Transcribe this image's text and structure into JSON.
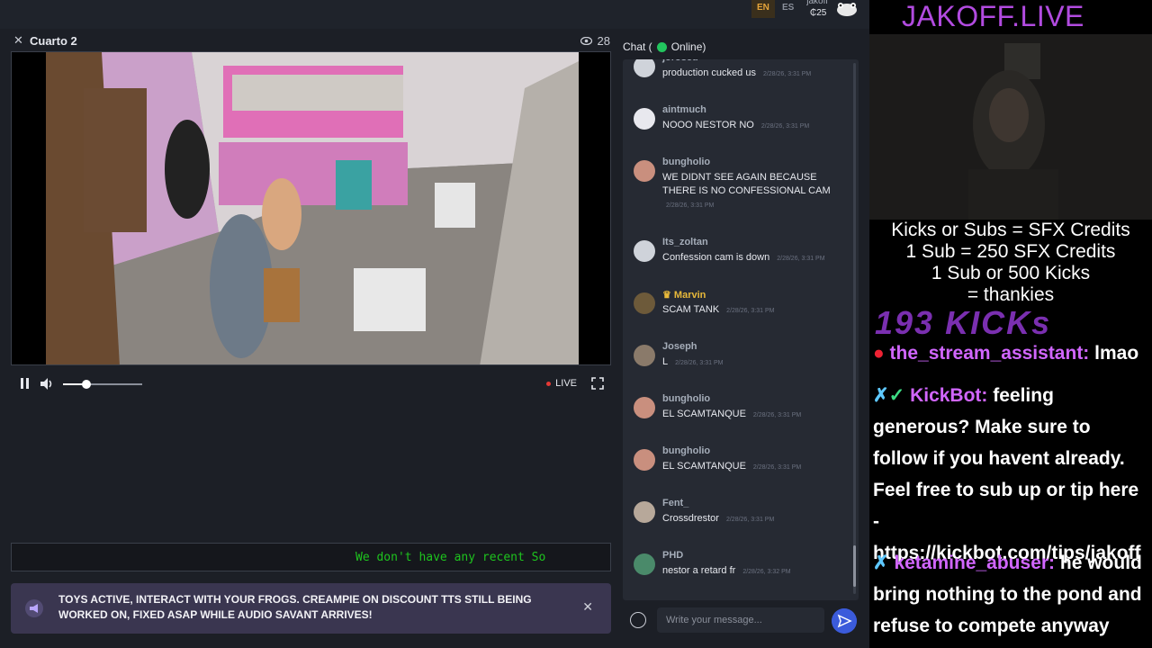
{
  "topbar": {
    "lang_en": "EN",
    "lang_es": "ES",
    "username": "jakoff",
    "credits": "₵25"
  },
  "room": {
    "title": "Cuarto 2",
    "viewers": "28",
    "live_label": "LIVE",
    "volume_fraction": 0.3
  },
  "ticker": {
    "text": "We don't have any recent So"
  },
  "banner": {
    "text": "TOYS ACTIVE, INTERACT WITH YOUR FROGS. CREAMPIE ON DISCOUNT TTS STILL BEING WORKED ON, FIXED ASAP WHILE AUDIO SAVANT ARRIVES!"
  },
  "chat": {
    "header_prefix": "Chat (",
    "header_status": "Online)",
    "placeholder": "Write your message...",
    "messages": [
      {
        "user": "jorosed",
        "text": "production cucked us",
        "time": "2/28/26, 3:31 PM"
      },
      {
        "user": "aintmuch",
        "text": "NOOO NESTOR NO",
        "time": "2/28/26, 3:31 PM"
      },
      {
        "user": "bungholio",
        "text": "WE DIDNT SEE AGAIN BECAUSE THERE IS NO CONFESSIONAL CAM",
        "time": "2/28/26, 3:31 PM"
      },
      {
        "user": "Its_zoltan",
        "text": "Confession cam is down",
        "time": "2/28/26, 3:31 PM"
      },
      {
        "user": "Marvin",
        "text": "SCAM TANK",
        "time": "2/28/26, 3:31 PM"
      },
      {
        "user": "Joseph",
        "text": "L",
        "time": "2/28/26, 3:31 PM"
      },
      {
        "user": "bungholio",
        "text": "EL SCAMTANQUE",
        "time": "2/28/26, 3:31 PM"
      },
      {
        "user": "bungholio",
        "text": "EL SCAMTANQUE",
        "time": "2/28/26, 3:31 PM"
      },
      {
        "user": "Fent_",
        "text": "Crossdrestor",
        "time": "2/28/26, 3:31 PM"
      },
      {
        "user": "PHD",
        "text": "nestor a retard fr",
        "time": "2/28/26, 3:32 PM"
      }
    ]
  },
  "stream": {
    "brand": "JAKOFF.LIVE",
    "credit_lines": [
      "Kicks or Subs = SFX Credits",
      "1 Sub = 250 SFX Credits",
      "1 Sub or 500 Kicks",
      "= thankies"
    ],
    "kicks": "193 KICKs",
    "chat": [
      {
        "user": "the_stream_assistant:",
        "text": " lmao"
      },
      {
        "user": "KickBot:",
        "text": " feeling generous? Make sure to follow if you havent already. Feel free to sub up or tip here - https://kickbot.com/tips/jakoff"
      },
      {
        "user": "ketamine_abuser:",
        "text": " he would bring nothing to the pond and refuse to compete anyway"
      }
    ]
  },
  "colors": {
    "accent": "#3b5bdb",
    "online": "#22c55e",
    "brand": "#b24be0",
    "ticker": "#1ec41e"
  }
}
